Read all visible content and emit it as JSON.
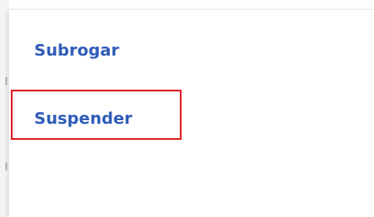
{
  "menu": {
    "items": [
      {
        "label": "Subrogar"
      },
      {
        "label": "Suspender"
      }
    ],
    "highlighted_index": 1
  },
  "colors": {
    "menu_text": "#2d5bb8",
    "highlight_border": "#e0242b",
    "background": "#ffffff"
  }
}
